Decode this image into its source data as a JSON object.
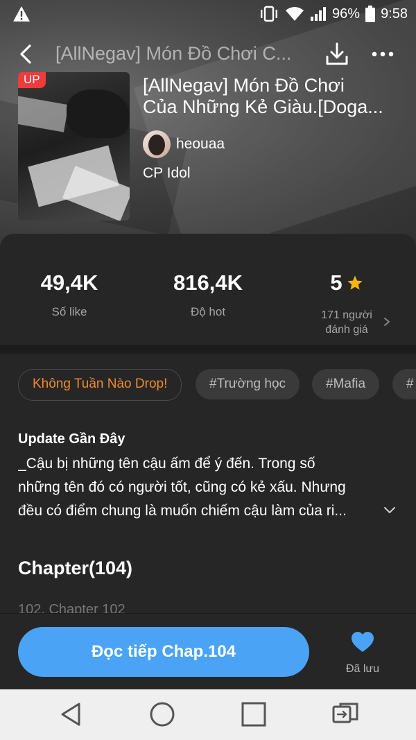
{
  "status_bar": {
    "battery_percent": "96%",
    "time": "9:58"
  },
  "nav": {
    "title": "[AllNegav] Món Đồ Chơi C..."
  },
  "book": {
    "badge": "UP",
    "title_line1": "[AllNegav] Món Đồ Chơi",
    "title_line2": "Của Những Kẻ Giàu.[Doga...",
    "author": "heouaa",
    "category": "CP Idol"
  },
  "stats": {
    "likes": {
      "value": "49,4K",
      "label": "Số like"
    },
    "hot": {
      "value": "816,4K",
      "label": "Độ hot"
    },
    "rating": {
      "value": "5",
      "label_line1": "171 người",
      "label_line2": "đánh giá"
    }
  },
  "tags": [
    {
      "label": "Không Tuần Nào Drop!",
      "highlight": true
    },
    {
      "label": "#Trường học",
      "highlight": false
    },
    {
      "label": "#Mafia",
      "highlight": false
    },
    {
      "label": "#",
      "highlight": false
    }
  ],
  "update": {
    "heading": "Update Gần Đây",
    "line1": "_Cậu bị những tên cậu ấm để ý đến. Trong số",
    "line2": "những tên đó có người tốt, cũng có kẻ xấu. Nhưng",
    "line3": "đều có điểm chung là muốn chiếm cậu làm của ri..."
  },
  "chapters": {
    "heading": "Chapter(104)",
    "partial_item": "102. Chapter 102"
  },
  "actions": {
    "read_label": "Đọc tiếp Chap.104",
    "saved_label": "Đã lưu"
  },
  "colors": {
    "accent": "#4aa3f5",
    "tag_highlight": "#f08a2a",
    "badge": "#ee3b3b",
    "star": "#f5b70f"
  }
}
